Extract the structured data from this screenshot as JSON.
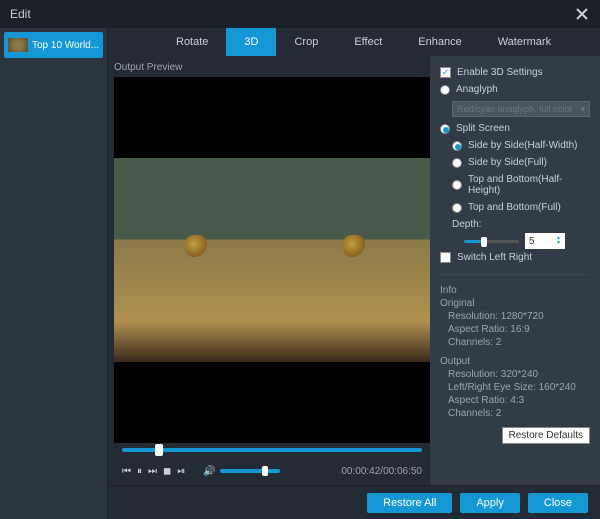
{
  "window": {
    "title": "Edit"
  },
  "sidebar": {
    "items": [
      {
        "label": "Top 10 World..."
      }
    ]
  },
  "tabs": [
    "Rotate",
    "3D",
    "Crop",
    "Effect",
    "Enhance",
    "Watermark"
  ],
  "preview": {
    "label": "Output Preview",
    "time": "00:00:42/00:06:50"
  },
  "settings": {
    "enable": "Enable 3D Settings",
    "anaglyph": {
      "label": "Anaglyph",
      "combo": "Red/cyan anaglyph, full color"
    },
    "split": {
      "label": "Split Screen",
      "options": [
        "Side by Side(Half-Width)",
        "Side by Side(Full)",
        "Top and Bottom(Half-Height)",
        "Top and Bottom(Full)"
      ]
    },
    "depth": {
      "label": "Depth:",
      "value": "5"
    },
    "switch": "Switch Left Right"
  },
  "info": {
    "header": "Info",
    "original": {
      "label": "Original",
      "resolution": "Resolution: 1280*720",
      "aspect": "Aspect Ratio: 16:9",
      "channels": "Channels: 2"
    },
    "output": {
      "label": "Output",
      "resolution": "Resolution: 320*240",
      "eyesize": "Left/Right Eye Size: 160*240",
      "aspect": "Aspect Ratio: 4:3",
      "channels": "Channels: 2"
    }
  },
  "buttons": {
    "restore_defaults": "Restore Defaults",
    "restore_all": "Restore All",
    "apply": "Apply",
    "close": "Close"
  }
}
